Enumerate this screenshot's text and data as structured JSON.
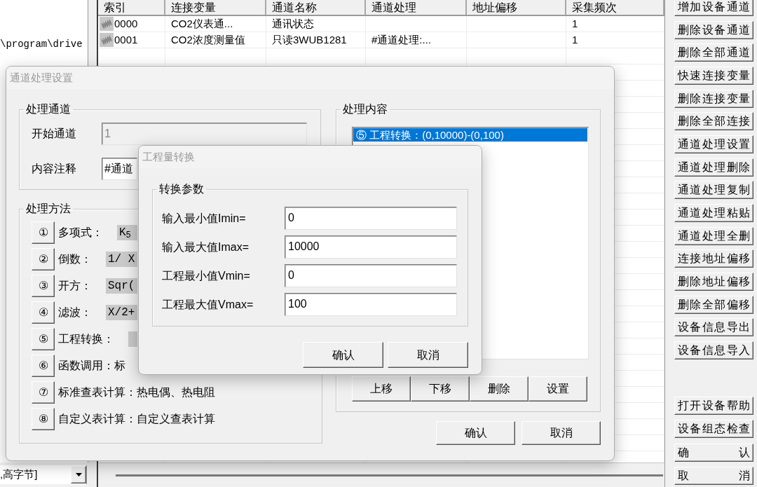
{
  "main_window": {
    "left_panel": {
      "path_text": "\\program\\drive",
      "dropdown": {
        "value": ",高字节]"
      }
    },
    "table": {
      "columns": [
        "索引",
        "连接变量",
        "通道名称",
        "通道处理",
        "地址偏移",
        "采集频次"
      ],
      "rows": [
        {
          "cells": [
            "0000",
            "CO2仪表通...",
            "通讯状态",
            null,
            null,
            "1"
          ]
        },
        {
          "cells": [
            "0001",
            "CO2浓度测量值",
            "只读3WUB1281",
            "#通道处理:...",
            null,
            "1"
          ]
        }
      ]
    },
    "side_buttons_top": [
      "增加设备通道",
      "删除设备通道",
      "删除全部通道",
      "快速连接变量",
      "删除连接变量",
      "删除全部连接",
      "通道处理设置",
      "通道处理删除",
      "通道处理复制",
      "通道处理粘贴",
      "通道处理全删",
      "连接地址偏移",
      "删除地址偏移",
      "删除全部偏移",
      "设备信息导出",
      "设备信息导入"
    ],
    "side_buttons_bottom": [
      "打开设备帮助",
      "设备组态检查",
      "确 认",
      "取 消"
    ]
  },
  "channel_processing_dialog": {
    "title": "通道处理设置",
    "channel_group": {
      "title": "处理通道",
      "fields": [
        {
          "label": "开始通道",
          "value": "1",
          "disabled": true
        },
        {
          "label": "内容注释",
          "value": "#通道",
          "disabled": false
        }
      ]
    },
    "method_group": {
      "title": "处理方法",
      "methods": [
        {
          "number": "①",
          "label": "多项式：",
          "kind": "formula",
          "formula": "K$_{5}$"
        },
        {
          "number": "②",
          "label": "倒数：",
          "kind": "formula",
          "formula": "1/ X"
        },
        {
          "number": "③",
          "label": "开方：",
          "kind": "formula",
          "formula": "Sqr("
        },
        {
          "number": "④",
          "label": "滤波：",
          "kind": "formula",
          "formula": "X/2+"
        },
        {
          "number": "⑤",
          "label": "工程转换：",
          "kind": "formula"
        },
        {
          "number": "⑥",
          "label": "函数调用：标",
          "kind": "text"
        },
        {
          "number": "⑦",
          "label": "标准查表计算：热电偶、热电阻",
          "kind": "text"
        },
        {
          "number": "⑧",
          "label": "自定义表计算：自定义查表计算",
          "kind": "text"
        }
      ]
    },
    "content_group": {
      "title": "处理内容",
      "items": [
        {
          "text": "⑤ 工程转换：(0,10000)-(0,100)",
          "selected": true
        }
      ],
      "buttons": [
        "上移",
        "下移",
        "删除",
        "设置"
      ]
    },
    "buttons": [
      "确认",
      "取消"
    ]
  },
  "conversion_dialog": {
    "title": "工程量转换",
    "group_title": "转换参数",
    "fields": [
      {
        "label": "输入最小值Imin=",
        "value": "0"
      },
      {
        "label": "输入最大值Imax=",
        "value": "10000"
      },
      {
        "label": "工程最小值Vmin=",
        "value": "0"
      },
      {
        "label": "工程最大值Vmax=",
        "value": "100"
      }
    ],
    "buttons": [
      "确认",
      "取消"
    ]
  }
}
